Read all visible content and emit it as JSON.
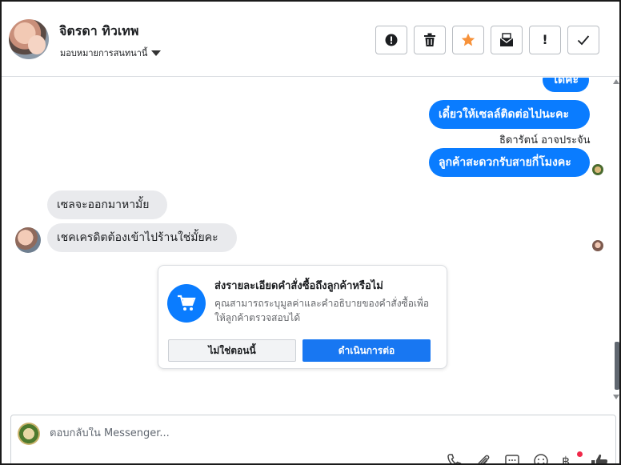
{
  "header": {
    "contact_name": "จิตรดา ทิวเทพ",
    "assign_label": "มอบหมายการสนทนานี้",
    "actions": [
      {
        "icon": "alert-circle-icon",
        "label": ""
      },
      {
        "icon": "trash-icon",
        "label": ""
      },
      {
        "icon": "star-icon",
        "label": ""
      },
      {
        "icon": "mark-unread-icon",
        "label": ""
      },
      {
        "icon": "spam-icon",
        "label": "!"
      },
      {
        "icon": "check-icon",
        "label": ""
      }
    ],
    "star_color": "#f7923a"
  },
  "messages": {
    "out_1_partial": "ได้คะ",
    "out_2": "เดี๋ยวให้เซลล์ติดต่อไปนะคะ",
    "sender_name": "ธิดารัตน์ อาจประจัน",
    "out_3": "ลูกค้าสะดวกรับสายกี่โมงคะ",
    "in_1": "เซลจะออกมาหามั้ย",
    "in_2": "เชคเครดิตต้องเข้าไปร้านใช่มั้ยคะ"
  },
  "order_card": {
    "icon": "cart-icon",
    "title": "ส่งรายละเอียดคำสั่งซื้อถึงลูกค้าหรือไม่",
    "description": "คุณสามารถระบุมูลค่าและคำอธิบายของคำสั่งซื้อเพื่อให้ลูกค้าตรวจสอบได้",
    "secondary_button": "ไม่ใช่ตอนนี้",
    "primary_button": "ดำเนินการต่อ"
  },
  "composer": {
    "placeholder": "ตอบกลับใน Messenger...",
    "value": "",
    "tools": [
      "phone-icon",
      "attachment-icon",
      "saved-replies-icon",
      "emoji-icon",
      "baht-icon",
      "like-icon"
    ],
    "baht_symbol": "฿"
  },
  "colors": {
    "accent": "#0a7cff",
    "button_primary": "#1877f2",
    "incoming_bubble": "#e9eaed",
    "notification_dot": "#f02849"
  }
}
